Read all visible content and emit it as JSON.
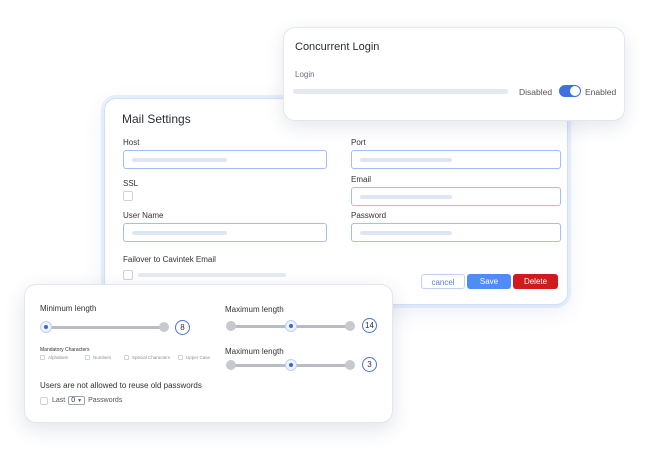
{
  "mail_settings": {
    "title": "Mail Settings",
    "host_label": "Host",
    "port_label": "Port",
    "ssl_label": "SSL",
    "email_label": "Email",
    "username_label": "User Name",
    "password_label": "Password",
    "failover_label": "Failover to Cavintek Email",
    "cancel_label": "cancel",
    "save_label": "Save",
    "delete_label": "Delete"
  },
  "concurrent_login": {
    "title": "Concurrent Login",
    "login_label": "Login",
    "disabled_label": "Disabled",
    "enabled_label": "Enabled",
    "toggle_state": "enabled"
  },
  "password_policy": {
    "min_length_label": "Minimum length",
    "min_length_value": "8",
    "max_length_label": "Maximum length",
    "max_length_value": "14",
    "max_length_label_2": "Maximum length",
    "max_length_value_2": "3",
    "mandatory_label": "Mandatory Characters",
    "options": [
      "Alphabets",
      "Numbers",
      "Special Characters",
      "Upper Case"
    ],
    "reuse_label": "Users are not allowed to reuse old passwords",
    "last_label": "Last",
    "last_value": "0",
    "passwords_label": "Passwords"
  },
  "colors": {
    "accent": "#4f8df6",
    "toggle_on": "#3f6fe0",
    "delete": "#cf1b1b"
  }
}
